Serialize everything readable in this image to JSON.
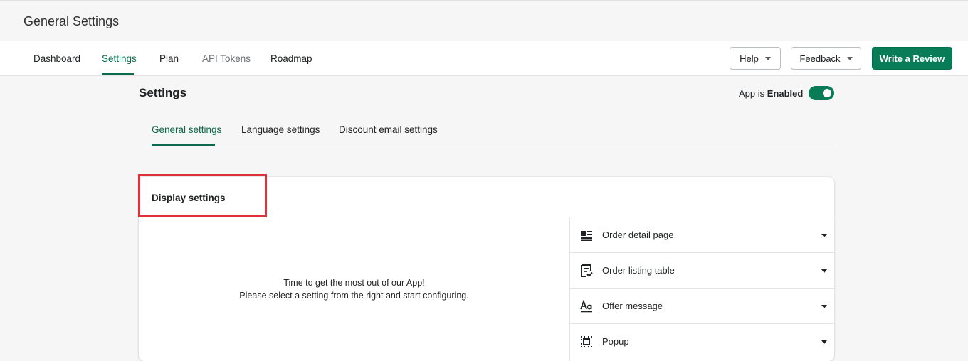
{
  "header": {
    "title": "General Settings"
  },
  "nav": {
    "tabs": [
      {
        "label": "Dashboard"
      },
      {
        "label": "Settings"
      },
      {
        "label": "Plan"
      },
      {
        "label": "API Tokens"
      },
      {
        "label": "Roadmap"
      }
    ],
    "active_tab": "Settings",
    "help_label": "Help",
    "feedback_label": "Feedback",
    "review_label": "Write a Review"
  },
  "page": {
    "heading": "Settings",
    "app_status_prefix": "App is",
    "app_status_value": "Enabled",
    "app_enabled": true
  },
  "sub_tabs": [
    {
      "label": "General settings"
    },
    {
      "label": "Language settings"
    },
    {
      "label": "Discount email settings"
    }
  ],
  "card": {
    "title": "Display settings",
    "empty_line1": "Time to get the most out of our App!",
    "empty_line2": "Please select a setting from the right and start configuring.",
    "options": [
      {
        "label": "Order detail page",
        "icon": "order-detail-icon"
      },
      {
        "label": "Order listing table",
        "icon": "order-listing-icon"
      },
      {
        "label": "Offer message",
        "icon": "text-style-icon"
      },
      {
        "label": "Popup",
        "icon": "popup-icon"
      }
    ]
  },
  "colors": {
    "accent": "#087c56",
    "highlight": "#e0303b"
  }
}
